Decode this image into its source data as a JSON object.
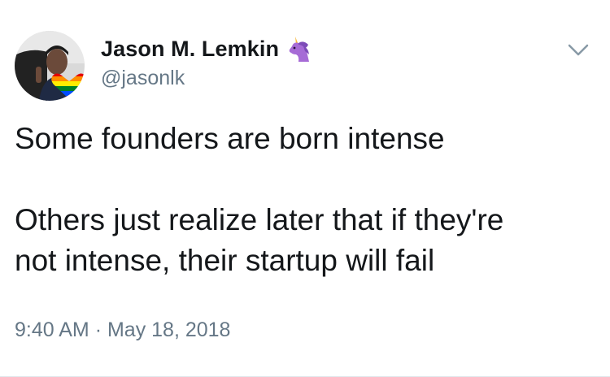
{
  "tweet": {
    "author": {
      "display_name": "Jason M. Lemkin",
      "handle": "@jasonlk",
      "name_emoji": "unicorn-icon"
    },
    "text_paragraphs": [
      "Some founders are born intense",
      "Others just realize later that if they're\nnot intense, their startup will fail"
    ],
    "time": "9:40 AM",
    "separator": "·",
    "date": "May 18, 2018",
    "menu_icon": "chevron-down-icon"
  },
  "colors": {
    "text": "#14171a",
    "secondary_text": "#657786",
    "divider": "#e1e8ed"
  }
}
